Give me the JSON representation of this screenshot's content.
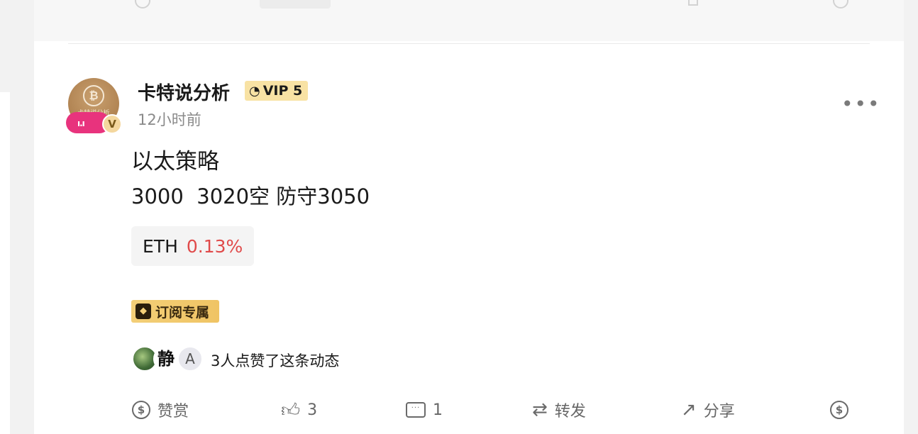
{
  "post": {
    "author": "卡特说分析",
    "vip_label": "VIP 5",
    "time": "12小时前",
    "title": "以太策略",
    "body": "3000  3020空 防守3050",
    "avatar_text": "卡特说分析",
    "avatar_badge": "V",
    "coin_tag": {
      "symbol": "ETH",
      "change": "0.13%",
      "change_color": "#e04a4a"
    },
    "subscription_badge": "订阅专属",
    "likers": {
      "avatar_2_char": "静",
      "avatar_3_char": "A",
      "summary": "3人点赞了这条动态"
    },
    "actions": {
      "tip_label": "赞赏",
      "like_count": "3",
      "comment_count": "1",
      "repost_label": "转发",
      "share_label": "分享"
    }
  },
  "colors": {
    "accent_red": "#e04a4a",
    "vip_bg": "#f8e2a4",
    "live_pink": "#e8337d"
  },
  "icons": [
    "more-icon",
    "tip-icon",
    "like-icon",
    "comment-icon",
    "repost-icon",
    "share-icon",
    "donate-icon",
    "diamond-icon",
    "live-icon"
  ]
}
